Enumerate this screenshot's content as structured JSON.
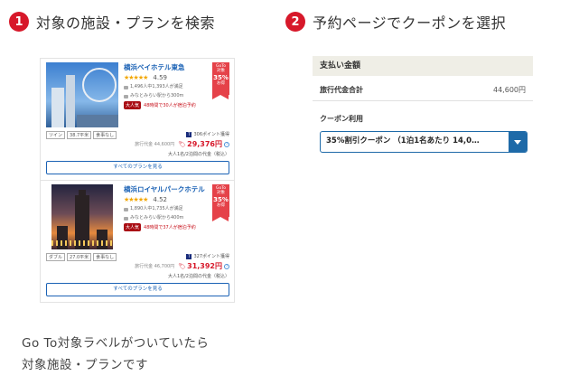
{
  "steps": [
    {
      "number": "1",
      "title": "対象の施設・プランを検索"
    },
    {
      "number": "2",
      "title": "予約ページでクーポンを選択"
    }
  ],
  "hotels": [
    {
      "name": "横浜ベイホテル東急",
      "stars": "★★★★★",
      "score": "4.59",
      "reviews": "1,496人中1,393人が満足",
      "access": "みなとみらい駅から300m",
      "popular_badge": "大人気",
      "popular_text": "48時間で30人が宿泊予約",
      "goto": {
        "top": "GoTo",
        "mid": "対象",
        "pct": "35%",
        "bottom": "お得"
      },
      "tags": [
        "ツイン",
        "38.7平米",
        "食事なし"
      ],
      "points": "306ポイント獲得",
      "old_price": "旅行代金 44,600円",
      "new_price": "29,376円",
      "per_night": "大人1名/2泊間の代金（税込）",
      "all_plans": "すべてのプランを見る"
    },
    {
      "name": "横浜ロイヤルパークホテル",
      "stars": "★★★★★",
      "score": "4.52",
      "reviews": "1,890人中1,735人が満足",
      "access": "みなとみらい駅から400m",
      "popular_badge": "大人気",
      "popular_text": "48時間で37人が宿泊予約",
      "goto": {
        "top": "GoTo",
        "mid": "対象",
        "pct": "35%",
        "bottom": "お得"
      },
      "tags": [
        "ダブル",
        "27.0平米",
        "食事なし"
      ],
      "points": "327ポイント獲得",
      "old_price": "旅行代金 46,700円",
      "new_price": "31,392円",
      "per_night": "大人1名/2泊間の代金（税込）",
      "all_plans": "すべてのプランを見る"
    }
  ],
  "caption": [
    "Go To対象ラベルがついていたら",
    "対象施設・プランです"
  ],
  "payment": {
    "header": "支払い金額",
    "total_label": "旅行代金合計",
    "total_value": "44,600円",
    "coupon_label": "クーポン利用",
    "coupon_selected": "35%割引クーポン （1泊1名あたり 14,0…"
  }
}
